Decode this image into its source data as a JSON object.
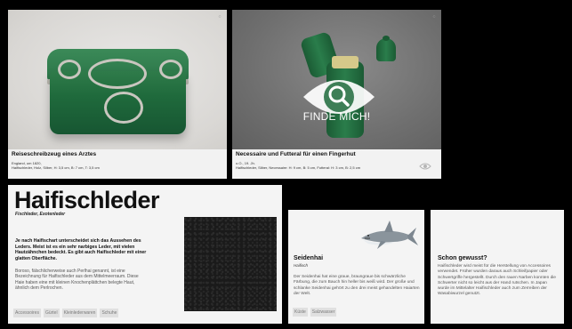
{
  "card1": {
    "title": "Reiseschreibzeug eines Arztes",
    "meta1": "England, um 1820,",
    "meta2": "Haifischleder, Holz, Silber, H: 3,5 cm, B: 7 cm, T: 3,5 cm"
  },
  "card2": {
    "title": "Necessaire und Futteral für einen Fingerhut",
    "meta1": "o.O., 19. Jh.",
    "meta2": "Haifischleder, Silber, Necessaire: H: 9 cm, B: 5 cm, Futteral: H: 3 cm, B: 2,5 cm",
    "overlay_text": "FINDE MICH!"
  },
  "article": {
    "title": "Haifischleder",
    "subtitle": "Fischleder, Exotenleder",
    "lead": "Je nach Haifischart unterscheidet sich das Aussehen des Leders. Meist ist es ein sehr narbiges Leder, mit vielen Hautzähnchen bedeckt. Es gibt auch Haifischleder mit einer glatten Oberfläche.",
    "body": "Boroso, fälschlicherweise auch Perlhai genannt, ist eine Bezeichnung für Haifischleder aus dem Mittelmeerraum. Diese Haie haben eine mit kleinen Knochenplättchen belegte Haut, ähnlich dem Perlrochen.",
    "tags": [
      "Accessoires",
      "Gürtel",
      "Kleinlederwaren",
      "Schuhe"
    ]
  },
  "shark_card": {
    "title": "Seidenhai",
    "subtitle": "Haifisch",
    "body": "Der Seidenhai hat eine graue, braungraue bis schwärzliche Färbung, die zum Bauch hin heller bis weiß wird. Der große und schlanke Seidenhai gehört zu den drei meist gehandelten Haiarten der Welt.",
    "tags": [
      "Küste",
      "Salzwasser"
    ]
  },
  "fact_card": {
    "title": "Schon gewusst?",
    "body": "Haifischleder wird meist für die Herstellung von Accessoires verwendet. Früher wurden daraus auch Schleifpapier oder Schwertgriffe hergestellt. Durch den rauen Narben konnten die Schwerter nicht so leicht aus der Hand rutschen. In Japan wurde im Mittelalter Haifischleder auch zum Zerreiben der Wasabiwurzel genutzt."
  },
  "icons": {
    "finde_icon": "eye-search-icon",
    "view_icon": "eye-icon"
  },
  "colors": {
    "leather_green": "#1f6a3c",
    "background": "#000000",
    "tag_bg": "#e0e0e0"
  }
}
